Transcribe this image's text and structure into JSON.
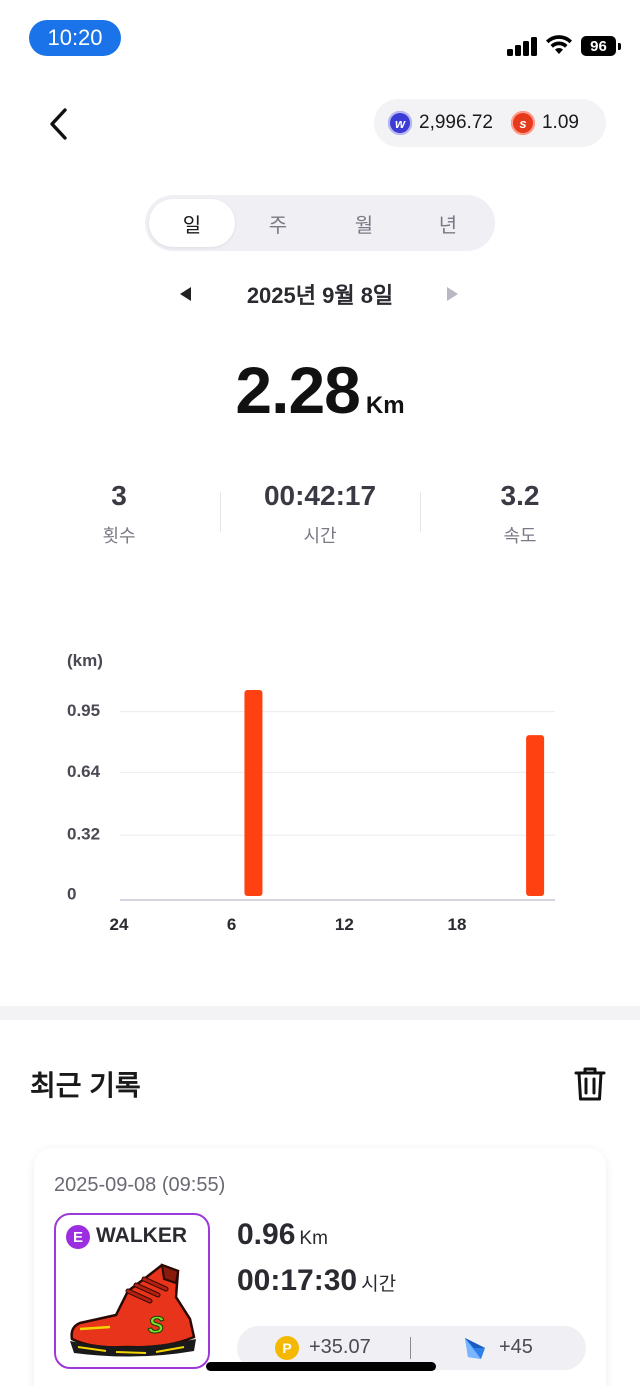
{
  "status_bar": {
    "time": "10:20",
    "battery": "96"
  },
  "header": {
    "tokens": [
      {
        "icon": "w-token-icon",
        "value": "2,996.72",
        "color": "#3b3bd6"
      },
      {
        "icon": "s-token-icon",
        "value": "1.09",
        "color": "#e63a1d"
      }
    ]
  },
  "tabs": [
    {
      "label": "일",
      "active": true
    },
    {
      "label": "주",
      "active": false
    },
    {
      "label": "월",
      "active": false
    },
    {
      "label": "년",
      "active": false
    }
  ],
  "date_nav": {
    "label": "2025년 9월 8일"
  },
  "summary": {
    "distance": "2.28",
    "distance_unit": "Km",
    "stats": [
      {
        "value": "3",
        "label": "횟수"
      },
      {
        "value": "00:42:17",
        "label": "시간"
      },
      {
        "value": "3.2",
        "label": "속도"
      }
    ]
  },
  "chart_data": {
    "type": "bar",
    "ylabel": "(km)",
    "y_ticks": [
      "0.95",
      "0.64",
      "0.32",
      "0"
    ],
    "y_tick_values": [
      0.95,
      0.64,
      0.32,
      0
    ],
    "ylim": [
      0,
      1.06
    ],
    "x_ticks": [
      "24",
      "6",
      "12",
      "18"
    ],
    "x_tick_hours": [
      0,
      6,
      12,
      18
    ],
    "xlim": [
      0,
      23
    ],
    "bars": [
      {
        "hour": 7,
        "value": 1.06
      },
      {
        "hour": 22,
        "value": 0.83
      }
    ],
    "bar_color": "#ff4010",
    "grid": true
  },
  "recent": {
    "title": "최근 기록",
    "records": [
      {
        "datetime": "2025-09-08 (09:55)",
        "shoe_grade": "E",
        "shoe_type": "WALKER",
        "distance": "0.96",
        "distance_unit": "Km",
        "duration": "00:17:30",
        "duration_unit": "시간",
        "point_reward": "+35.07",
        "gem_reward": "+45"
      }
    ]
  }
}
